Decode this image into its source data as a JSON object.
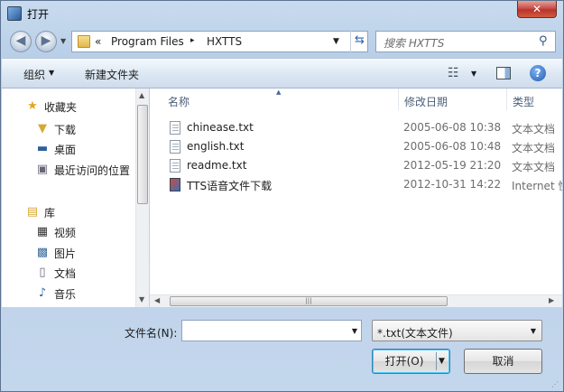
{
  "window": {
    "title": "打开",
    "close_label": "✕"
  },
  "address": {
    "prefix": "«",
    "crumbs": [
      "Program Files",
      "HXTTS"
    ],
    "separator": "▸"
  },
  "search": {
    "placeholder": "搜索 HXTTS"
  },
  "toolbar": {
    "organize_label": "组织",
    "new_folder_label": "新建文件夹",
    "help_label": "?"
  },
  "nav": {
    "favorites": {
      "label": "收藏夹",
      "items": [
        "下载",
        "桌面",
        "最近访问的位置"
      ]
    },
    "libraries": {
      "label": "库",
      "items": [
        "视频",
        "图片",
        "文档",
        "音乐"
      ]
    }
  },
  "columns": {
    "name": "名称",
    "date": "修改日期",
    "type": "类型"
  },
  "files": [
    {
      "name": "chinease.txt",
      "date": "2005-06-08 10:38",
      "type": "文本文档",
      "icon": "text-file-icon"
    },
    {
      "name": "english.txt",
      "date": "2005-06-08 10:48",
      "type": "文本文档",
      "icon": "text-file-icon"
    },
    {
      "name": "readme.txt",
      "date": "2012-05-19 21:20",
      "type": "文本文档",
      "icon": "text-file-icon"
    },
    {
      "name": "TTS语音文件下载",
      "date": "2012-10-31 14:22",
      "type": "Internet 快",
      "icon": "internet-shortcut-icon"
    }
  ],
  "bottom": {
    "filename_label": "文件名(N):",
    "filename_value": "",
    "filter_value": "*.txt(文本文件)",
    "open_label": "打开(O)",
    "cancel_label": "取消"
  },
  "colors": {
    "accent": "#3c7fb1",
    "close": "#c75050"
  }
}
